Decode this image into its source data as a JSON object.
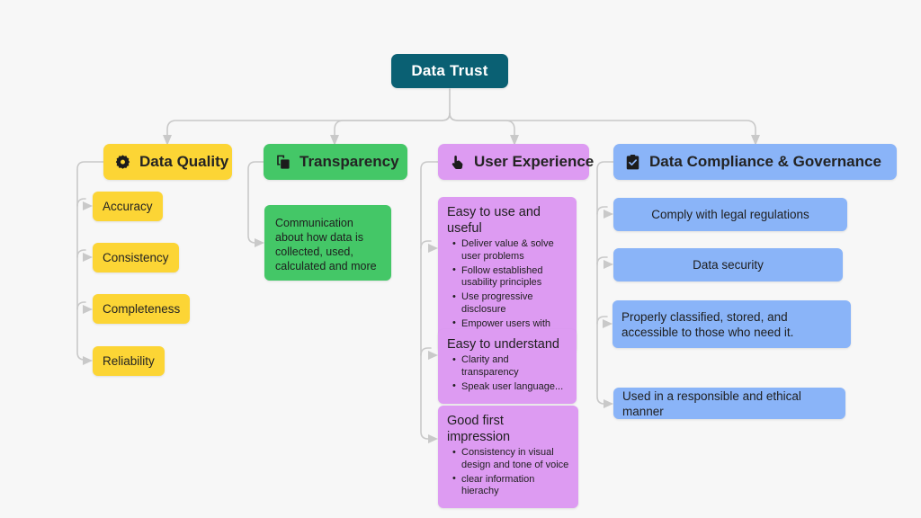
{
  "diagram": {
    "title": "Data Trust mind map",
    "background_color": "#f7f7f7",
    "link_color": "#c9c9c9"
  },
  "root": {
    "label": "Data Trust",
    "color": "#0a6073",
    "text_color": "#ffffff"
  },
  "branches": [
    {
      "id": "data-quality",
      "label": "Data Quality",
      "icon": "gear-icon",
      "color": "#fcd535",
      "children": [
        {
          "label": "Accuracy"
        },
        {
          "label": "Consistency"
        },
        {
          "label": "Completeness"
        },
        {
          "label": "Reliability"
        }
      ]
    },
    {
      "id": "transparency",
      "label": "Transparency",
      "icon": "copy-layers-icon",
      "color": "#44c767",
      "children": [
        {
          "label": "Communication about how data is collected, used, calculated and more"
        }
      ]
    },
    {
      "id": "user-experience",
      "label": "User Experience",
      "icon": "pointing-hand-icon",
      "color": "#dd9bf2",
      "children": [
        {
          "title": "Easy to use and useful",
          "bullets": [
            "Deliver value & solve user problems",
            "Follow established usability principles",
            "Use progressive disclosure",
            "Empower users with control"
          ]
        },
        {
          "title": "Easy to understand",
          "bullets": [
            "Clarity and transparency",
            "Speak user language..."
          ]
        },
        {
          "title": "Good first impression",
          "bullets": [
            "Consistency in visual design and tone of voice",
            "clear information hierachy"
          ]
        }
      ]
    },
    {
      "id": "data-compliance-governance",
      "label": "Data Compliance & Governance",
      "icon": "clipboard-check-icon",
      "color": "#8ab4f8",
      "children": [
        {
          "label": "Comply with legal regulations"
        },
        {
          "label": "Data security"
        },
        {
          "label": "Properly classified, stored, and accessible to those who need it."
        },
        {
          "label": "Used in a responsible and ethical manner"
        }
      ]
    }
  ]
}
